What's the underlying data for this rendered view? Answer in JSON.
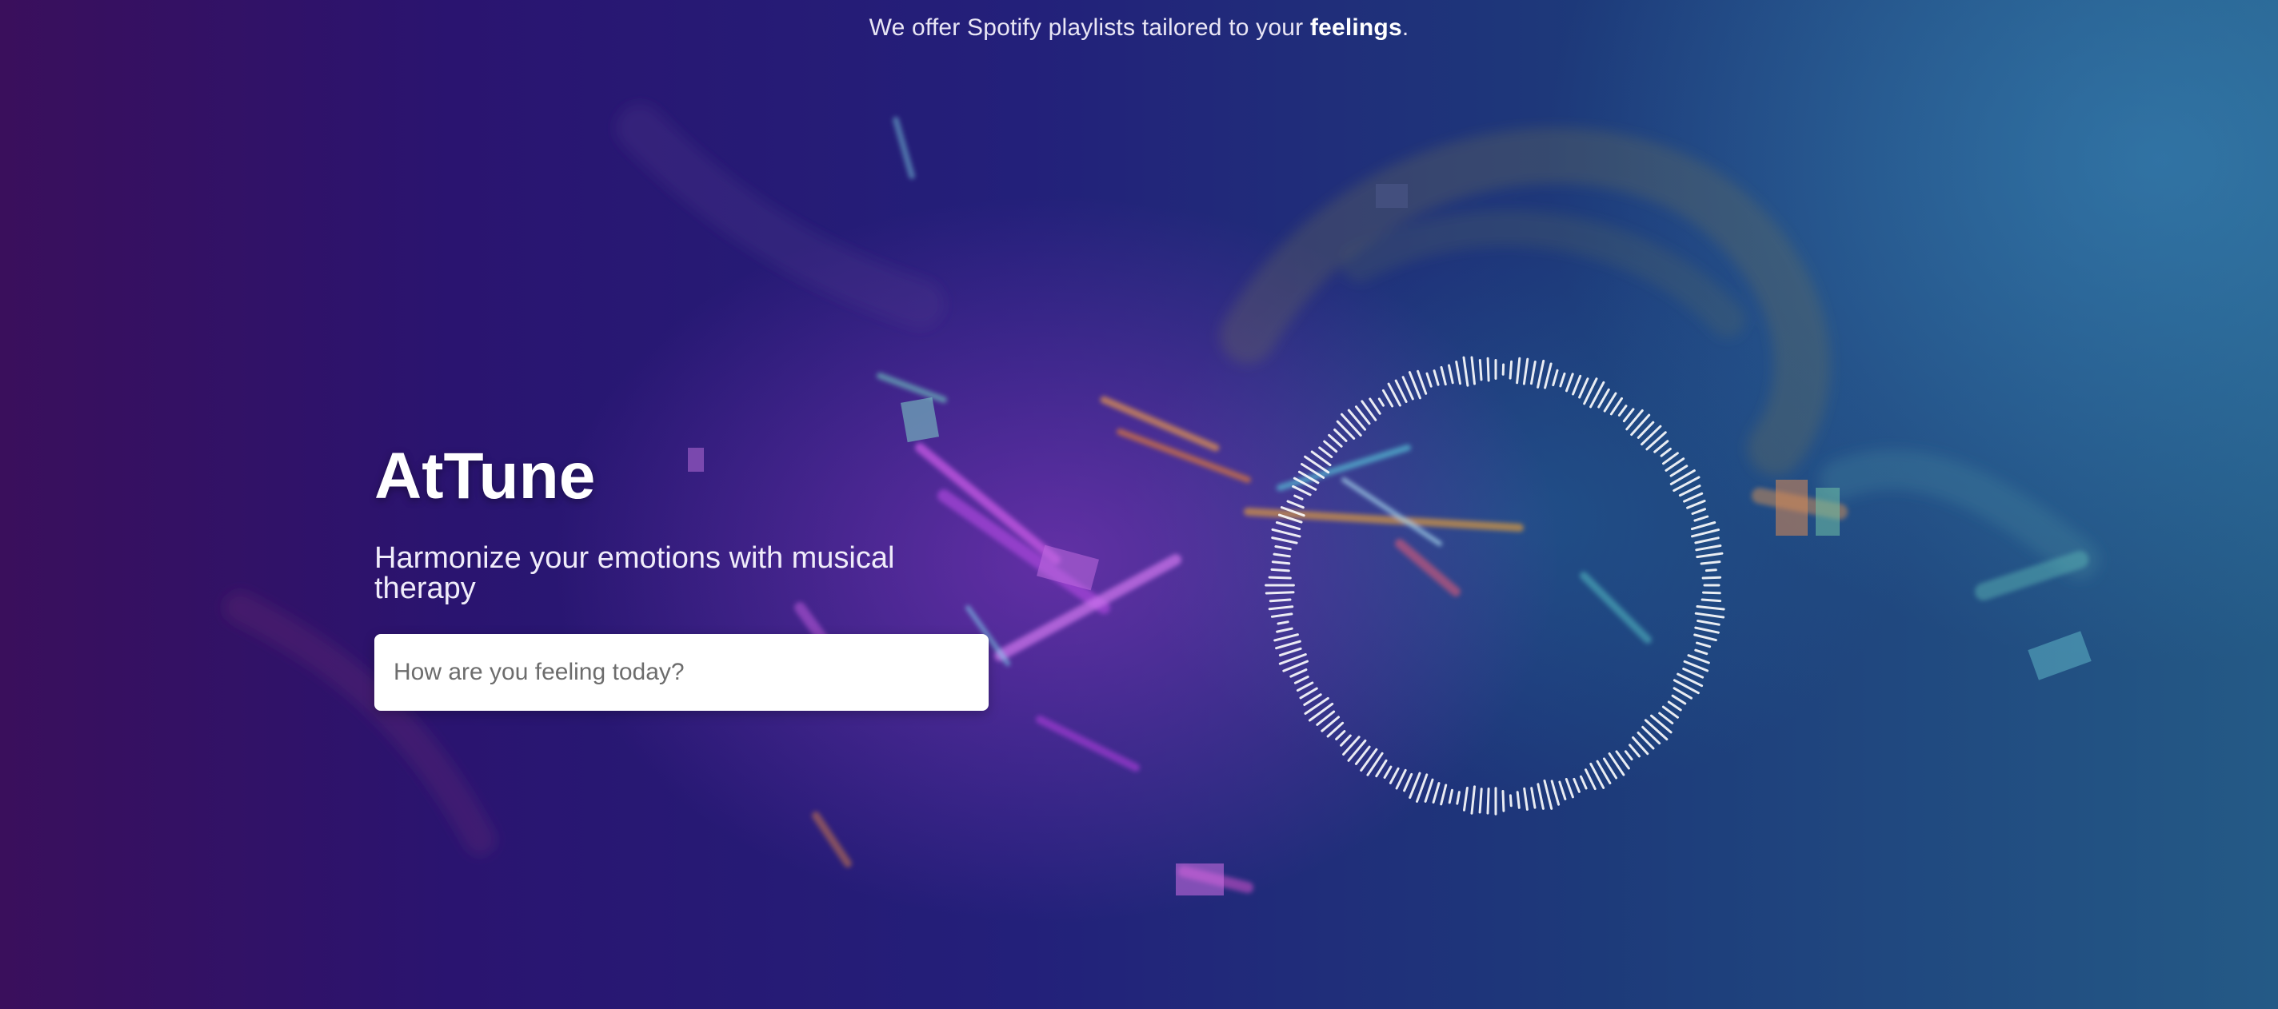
{
  "page": {
    "tagline_prefix": "We offer Spotify playlists tailored to your ",
    "tagline_emphasis": "feelings",
    "tagline_suffix": "."
  },
  "hero": {
    "brand": "AtTune",
    "subtitle": "Harmonize your emotions with musical therapy",
    "input_placeholder": "How are you feeling today?",
    "input_value": ""
  },
  "theme": {
    "background_left": "#3a0f5c",
    "background_right": "#245a86",
    "accent_purple": "#a24bd8",
    "accent_cyan": "#4fb7d6",
    "text": "#ffffff"
  },
  "icons": {
    "visualizer": "audio-visualizer-ring"
  }
}
